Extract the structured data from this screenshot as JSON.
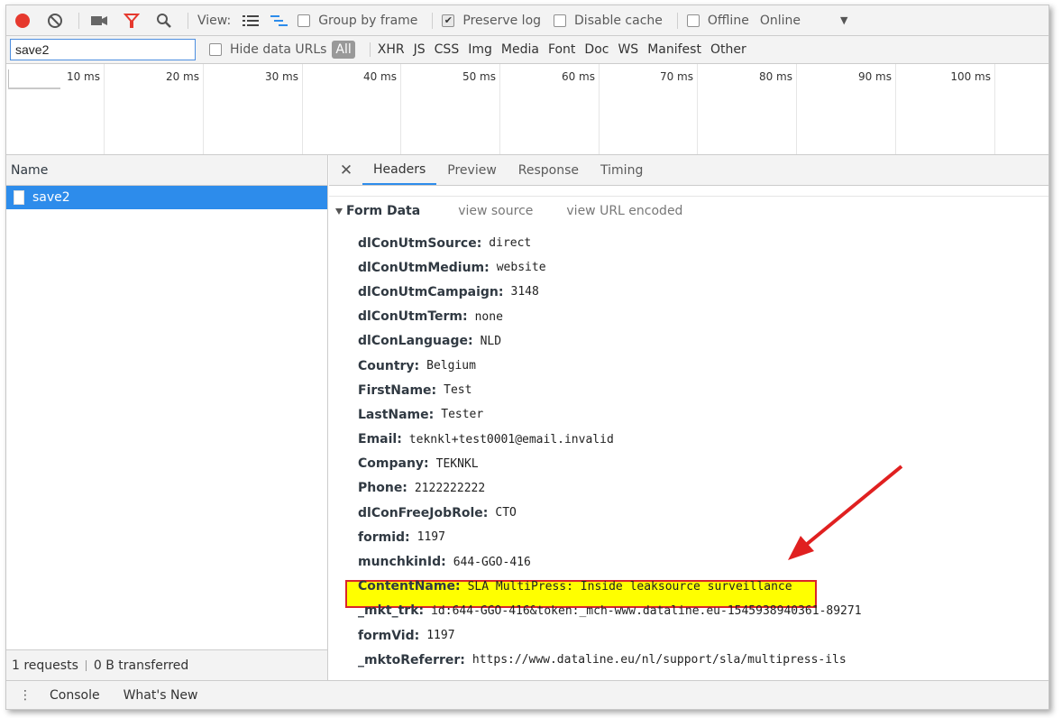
{
  "toolbar": {
    "view_label": "View:",
    "group_by_frame": "Group by frame",
    "preserve_log": "Preserve log",
    "disable_cache": "Disable cache",
    "offline": "Offline",
    "throttling": "Online",
    "icons": [
      "record-icon",
      "clear-icon",
      "camera-icon",
      "filter-icon",
      "search-icon",
      "list-view-icon",
      "waterfall-view-icon"
    ]
  },
  "filter": {
    "value": "save2",
    "hide_data_urls": "Hide data URLs",
    "types": [
      "All",
      "XHR",
      "JS",
      "CSS",
      "Img",
      "Media",
      "Font",
      "Doc",
      "WS",
      "Manifest",
      "Other"
    ]
  },
  "overview": {
    "ticks": [
      "10 ms",
      "20 ms",
      "30 ms",
      "40 ms",
      "50 ms",
      "60 ms",
      "70 ms",
      "80 ms",
      "90 ms",
      "100 ms"
    ]
  },
  "requests": {
    "column_header": "Name",
    "items": [
      {
        "name": "save2"
      }
    ],
    "summary_count": "1 requests",
    "summary_transferred": "0 B transferred"
  },
  "details": {
    "tabs": [
      "Headers",
      "Preview",
      "Response",
      "Timing"
    ],
    "active_tab": "Headers",
    "section_title": "Form Data",
    "view_source": "view source",
    "view_url_encoded": "view URL encoded",
    "form_data": [
      {
        "key": "dlConUtmSource:",
        "value": "direct"
      },
      {
        "key": "dlConUtmMedium:",
        "value": "website"
      },
      {
        "key": "dlConUtmCampaign:",
        "value": "3148"
      },
      {
        "key": "dlConUtmTerm:",
        "value": "none"
      },
      {
        "key": "dlConLanguage:",
        "value": "NLD"
      },
      {
        "key": "Country:",
        "value": "Belgium"
      },
      {
        "key": "FirstName:",
        "value": "Test"
      },
      {
        "key": "LastName:",
        "value": "Tester"
      },
      {
        "key": "Email:",
        "value": "teknkl+test0001@email.invalid"
      },
      {
        "key": "Company:",
        "value": "TEKNKL"
      },
      {
        "key": "Phone:",
        "value": "2122222222"
      },
      {
        "key": "dlConFreeJobRole:",
        "value": "CTO"
      },
      {
        "key": "formid:",
        "value": "1197"
      },
      {
        "key": "munchkinId:",
        "value": "644-GGO-416"
      },
      {
        "key": "ContentName:",
        "value": "SLA MultiPress: Inside leaksource surveillance"
      },
      {
        "key": "_mkt_trk:",
        "value": "id:644-GGO-416&token:_mch-www.dataline.eu-1545938940361-89271"
      },
      {
        "key": "formVid:",
        "value": "1197"
      },
      {
        "key": "_mktoReferrer:",
        "value": "https://www.dataline.eu/nl/support/sla/multipress-ils"
      }
    ]
  },
  "drawer": {
    "tabs": [
      "Console",
      "What's New"
    ]
  },
  "colors": {
    "accent": "#2d8ceb",
    "record": "#e6392e",
    "highlight": "#ffff00",
    "annotation": "#e02020"
  }
}
